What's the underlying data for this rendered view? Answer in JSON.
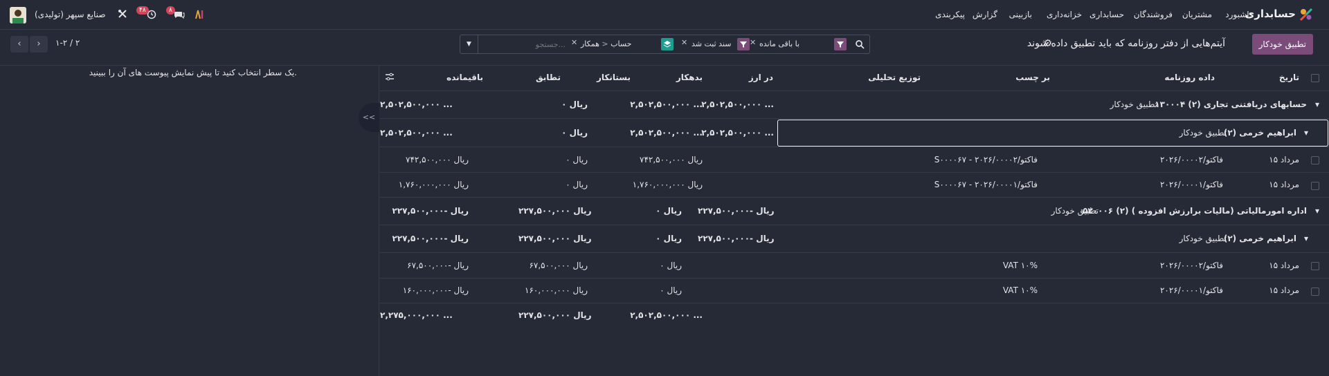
{
  "nav": {
    "brand": "حسابداری",
    "items": [
      "داشبورد",
      "مشتریان",
      "فروشندگان",
      "حسابداری",
      "خزانه‌داری",
      "بازبینی",
      "گزارش",
      "پیکربندی"
    ],
    "company": "صنایع سپهر (تولیدی)",
    "badge_messages": "۸",
    "badge_activities": "۴۸"
  },
  "control": {
    "auto_reconcile_label": "تطبیق خودکار",
    "title": "آیتم‌هایی از دفتر روزنامه که باید تطبیق داده شوند",
    "search_placeholder": "جستجو...",
    "facets": {
      "remaining": "با باقی مانده",
      "posted": "سند ثبت شد",
      "group_account": "حساب",
      "group_partner": "همکار"
    },
    "pager_value": "۱-۲ / ۲"
  },
  "preview": {
    "message": "یک سطر انتخاب کنید تا پیش نمایش پیوست های آن را ببینید."
  },
  "table": {
    "headers": {
      "date": "تاریخ",
      "journal": "داده روزنامه",
      "label": "بر چسب",
      "analytic": "توزیع تحلیلی",
      "currency": "در ارز",
      "debit": "بدهکار",
      "credit": "بستانکار",
      "matching": "تطابق",
      "residual": "باقیمانده"
    },
    "reconcile_link": "تطبیق خودکار",
    "groups": [
      {
        "account": "۱۳۰۰۰۴ حسابهای دریافتنی تجاری (۲)",
        "currency": "۲,۵۰۲,۵۰۰,۰۰۰ ...",
        "debit": "۲,۵۰۲,۵۰۰,۰۰۰ ...",
        "credit": "ریال ۰",
        "residual": "۲,۵۰۲,۵۰۰,۰۰۰ ...",
        "partner": {
          "name": "ابراهیم خرمی (۲)",
          "currency": "۲,۵۰۲,۵۰۰,۰۰۰ ...",
          "debit": "۲,۵۰۲,۵۰۰,۰۰۰ ...",
          "credit": "ریال ۰",
          "residual": "۲,۵۰۲,۵۰۰,۰۰۰ ..."
        },
        "lines": [
          {
            "date": "۱۵ مرداد",
            "journal": "فاکتو/۲۰۲۶/۰۰۰۰۲",
            "label": "S۰۰۰۰۶۷ - فاکتو/۲۰۲۶/۰۰۰۰۲",
            "debit": "ریال ۷۴۲,۵۰۰,۰۰۰",
            "credit": "ریال ۰",
            "residual": "ریال ۷۴۲,۵۰۰,۰۰۰"
          },
          {
            "date": "۱۵ مرداد",
            "journal": "فاکتو/۲۰۲۶/۰۰۰۰۱",
            "label": "S۰۰۰۰۶۷ - فاکتو/۲۰۲۶/۰۰۰۰۱",
            "debit": "ریال ۱,۷۶۰,۰۰۰,۰۰۰",
            "credit": "ریال ۰",
            "residual": "ریال ۱,۷۶۰,۰۰۰,۰۰۰"
          }
        ]
      },
      {
        "account": "۵۲۰۰۰۶ اداره امورمالیاتی (مالیات برارزش افزوده ) (۲)",
        "currency": "ریال -۲۲۷,۵۰۰,۰۰۰",
        "debit": "ریال ۰",
        "credit": "ریال ۲۲۷,۵۰۰,۰۰۰",
        "residual": "ریال -۲۲۷,۵۰۰,۰۰۰",
        "partner": {
          "name": "ابراهیم خرمی (۲)",
          "currency": "ریال -۲۲۷,۵۰۰,۰۰۰",
          "debit": "ریال ۰",
          "credit": "ریال ۲۲۷,۵۰۰,۰۰۰",
          "residual": "ریال -۲۲۷,۵۰۰,۰۰۰"
        },
        "lines": [
          {
            "date": "۱۵ مرداد",
            "journal": "فاکتو/۲۰۲۶/۰۰۰۰۲",
            "label": "VAT ۱۰%",
            "debit": "ریال ۰",
            "credit": "ریال ۶۷,۵۰۰,۰۰۰",
            "residual": "ریال -۶۷,۵۰۰,۰۰۰"
          },
          {
            "date": "۱۵ مرداد",
            "journal": "فاکتو/۲۰۲۶/۰۰۰۰۱",
            "label": "VAT ۱۰%",
            "debit": "ریال ۰",
            "credit": "ریال ۱۶۰,۰۰۰,۰۰۰",
            "residual": "ریال -۱۶۰,۰۰۰,۰۰۰"
          }
        ]
      }
    ],
    "totals": {
      "debit": "۲,۵۰۲,۵۰۰,۰۰۰ ...",
      "credit": "ریال ۲۲۷,۵۰۰,۰۰۰",
      "residual": "۲,۲۷۵,۰۰۰,۰۰۰ ..."
    }
  }
}
